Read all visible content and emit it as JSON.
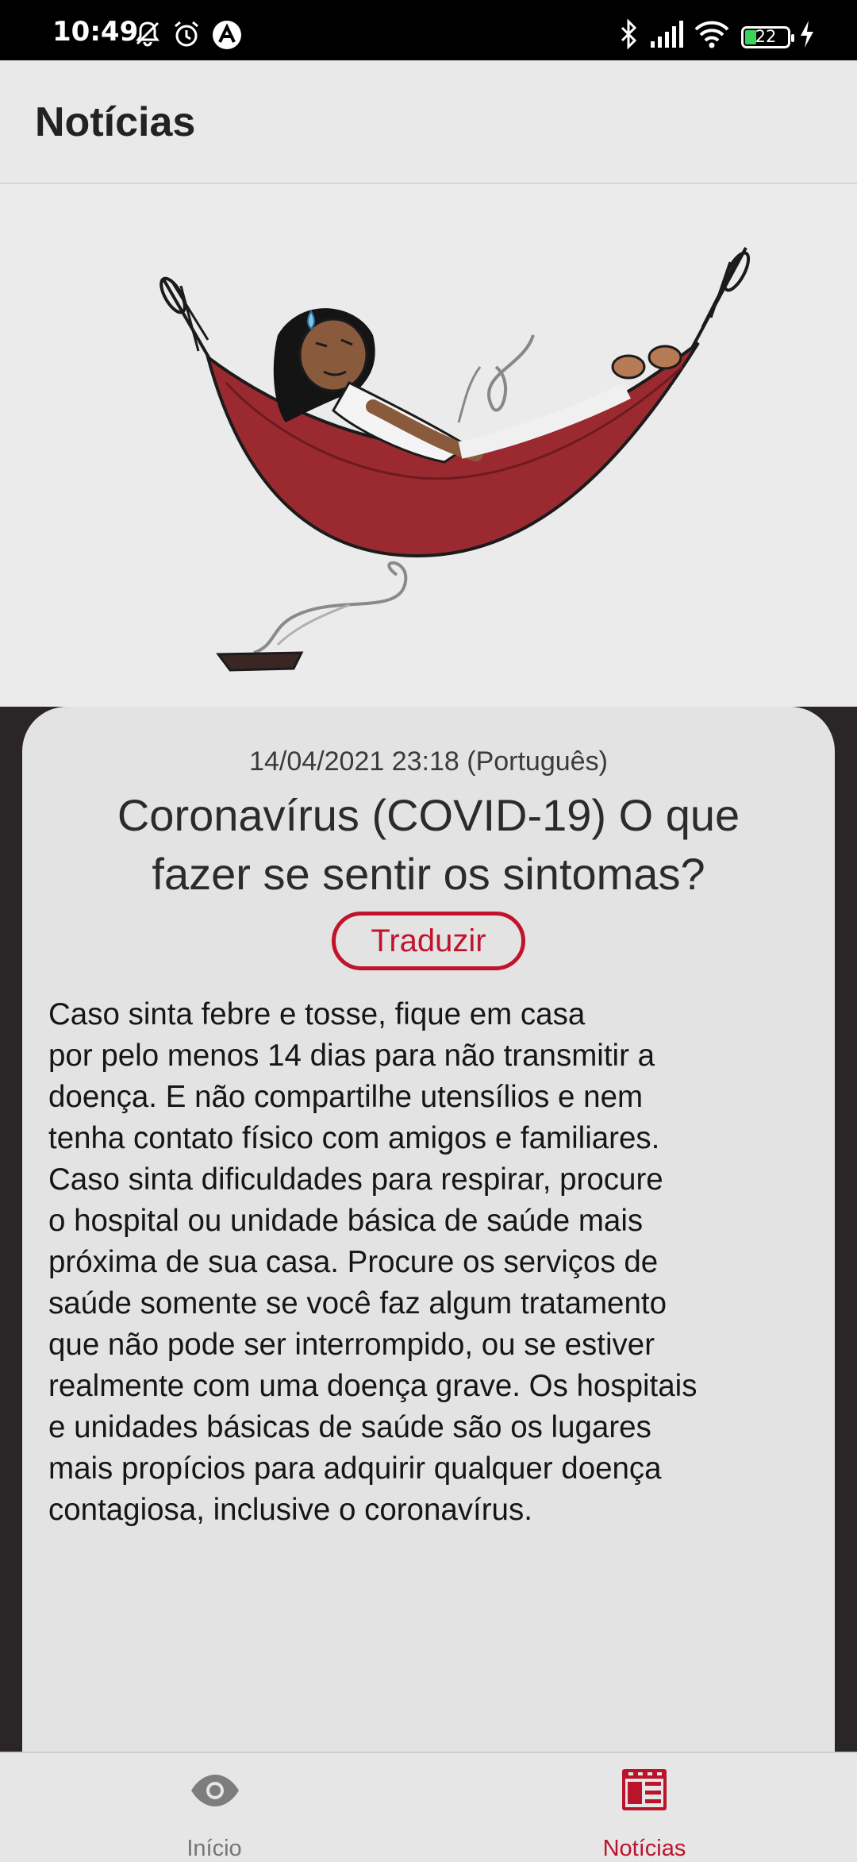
{
  "status_bar": {
    "time": "10:49",
    "battery_level": "22",
    "icons": [
      "bell-off-icon",
      "alarm-icon",
      "app-notification-icon",
      "bluetooth-icon",
      "signal-icon",
      "wifi-icon",
      "battery-icon",
      "charging-icon"
    ]
  },
  "app_bar": {
    "title": "Notícias"
  },
  "article": {
    "date": "14/04/2021 23:18 (Português)",
    "title": "Coronavírus (COVID-19) O que fazer se sentir os sintomas?",
    "translate_label": "Traduzir",
    "body": "    Caso sinta febre e tosse, fique em casa\npor pelo menos 14 dias para não transmitir a\ndoença. E não compartilhe utensílios e nem\ntenha contato físico com amigos e familiares.\nCaso sinta dificuldades para respirar, procure\no hospital ou unidade básica de saúde mais\npróxima de sua casa. Procure os serviços de\nsaúde somente se você faz algum tratamento\nque não pode ser interrompido, ou se estiver\nrealmente com uma doença grave. Os hospitais\ne unidades básicas de saúde são os lugares\nmais propícios para adquirir qualquer doença\ncontagiosa, inclusive o coronavírus."
  },
  "bottom_nav": {
    "items": [
      {
        "label": "Início",
        "icon": "eye-icon",
        "active": false
      },
      {
        "label": "Notícias",
        "icon": "newspaper-icon",
        "active": true
      }
    ]
  },
  "colors": {
    "accent": "#c0132c",
    "dark_band": "#2a2627",
    "card": "#e3e3e3",
    "hammock": "#9b2a30"
  }
}
